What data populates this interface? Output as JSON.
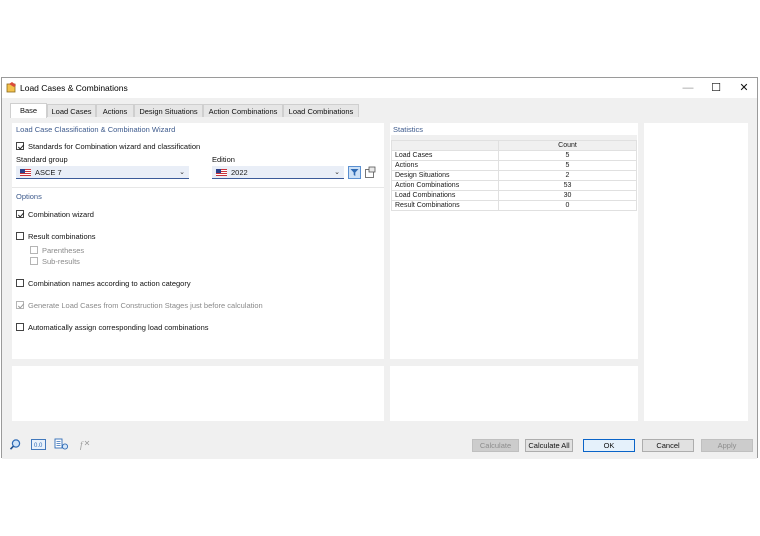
{
  "window": {
    "title": "Load Cases & Combinations"
  },
  "tabs": [
    "Base",
    "Load Cases",
    "Actions",
    "Design Situations",
    "Action Combinations",
    "Load Combinations"
  ],
  "classification": {
    "section_title": "Load Case Classification & Combination Wizard",
    "standards_checkbox_label": "Standards for Combination wizard and classification",
    "standards_checked": true,
    "standard_group_label": "Standard group",
    "standard_group_value": "ASCE 7",
    "edition_label": "Edition",
    "edition_value": "2022"
  },
  "options": {
    "section_title": "Options",
    "combination_wizard": "Combination wizard",
    "result_combinations": "Result combinations",
    "parentheses": "Parentheses",
    "sub_results": "Sub-results",
    "combination_names": "Combination names according to action category",
    "generate_load_cases": "Generate Load Cases from Construction Stages just before calculation",
    "auto_assign": "Automatically assign corresponding load combinations"
  },
  "statistics": {
    "section_title": "Statistics",
    "count_header": "Count",
    "rows": [
      {
        "label": "Load Cases",
        "count": "5"
      },
      {
        "label": "Actions",
        "count": "5"
      },
      {
        "label": "Design Situations",
        "count": "2"
      },
      {
        "label": "Action Combinations",
        "count": "53"
      },
      {
        "label": "Load Combinations",
        "count": "30"
      },
      {
        "label": "Result Combinations",
        "count": "0"
      }
    ]
  },
  "buttons": {
    "calculate": "Calculate",
    "calculate_all": "Calculate All",
    "ok": "OK",
    "cancel": "Cancel",
    "apply": "Apply"
  },
  "colors": {
    "accent": "#3b5a99",
    "section_title": "#3d5a8c",
    "default_button": "#0a64c8"
  }
}
